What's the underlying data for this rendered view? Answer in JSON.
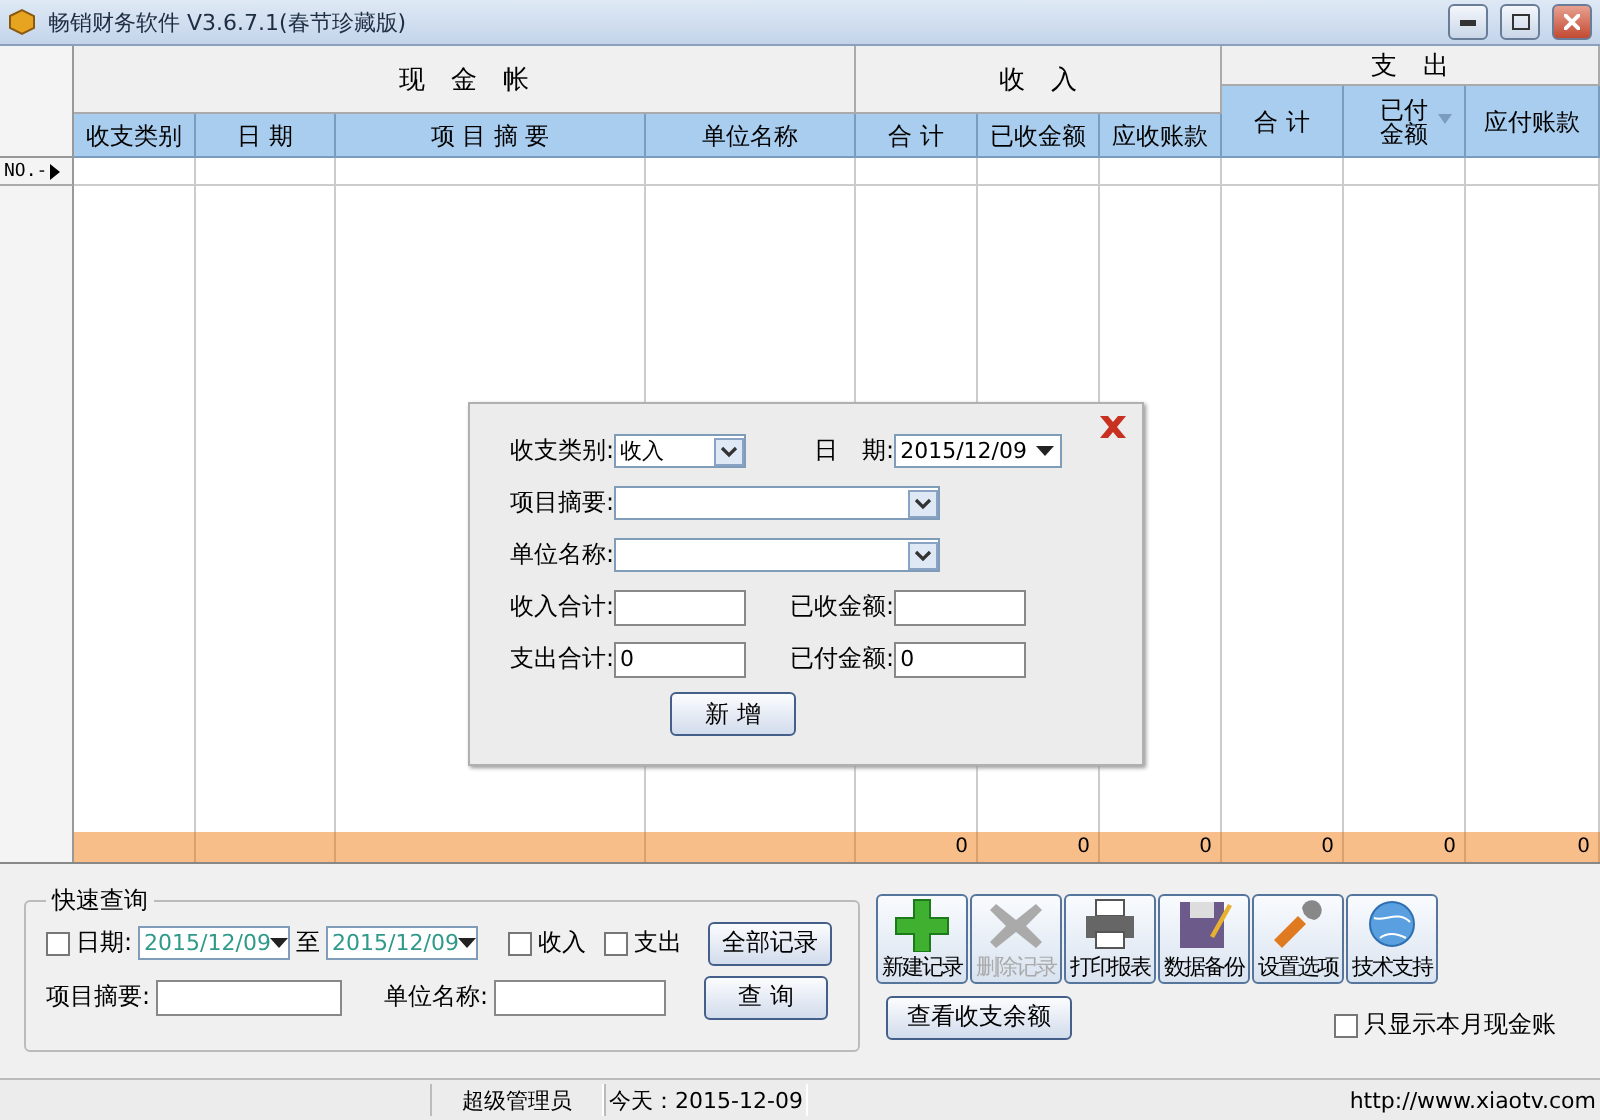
{
  "window": {
    "title": "畅销财务软件 V3.6.7.1(春节珍藏版)"
  },
  "grid": {
    "groups": [
      {
        "label": "现　金　帐"
      },
      {
        "label": "收　入"
      },
      {
        "label": "支　出"
      }
    ],
    "columns": [
      {
        "label": "收支类别",
        "filter": false
      },
      {
        "label": "日 期",
        "filter": false
      },
      {
        "label": "项 目 摘 要",
        "filter": false
      },
      {
        "label": "单位名称",
        "filter": false
      },
      {
        "label": "合 计",
        "filter": false
      },
      {
        "label": "已收金额",
        "filter": false
      },
      {
        "label": "应收账款",
        "filter": false
      },
      {
        "label": "合 计",
        "filter": false
      },
      {
        "label": "已付金额",
        "filter": true
      },
      {
        "label": "应付账款",
        "filter": false
      }
    ],
    "row_header": "NO.-",
    "totals": [
      "0",
      "0",
      "0",
      "0",
      "0",
      "0"
    ]
  },
  "dialog": {
    "type_label": "收支类别:",
    "type_value": "收入",
    "date_label": "日　期:",
    "date_value": "2015/12/09",
    "summary_label": "项目摘要:",
    "unit_label": "单位名称:",
    "income_total_label": "收入合计:",
    "received_label": "已收金额:",
    "expense_total_label": "支出合计:",
    "expense_total_value": "0",
    "paid_label": "已付金额:",
    "paid_value": "0",
    "button": "新 增"
  },
  "quick_query": {
    "title": "快速查询",
    "date_filter": {
      "label": "日期:",
      "checked": false
    },
    "from": "2015/12/09",
    "to_label": "至",
    "to": "2015/12/09",
    "income": {
      "label": "收入",
      "checked": false
    },
    "expense": {
      "label": "支出",
      "checked": false
    },
    "all_button": "全部记录",
    "summary_label": "项目摘要:",
    "unit_label": "单位名称:",
    "query_button": "查 询"
  },
  "toolbar": [
    {
      "kind": "add",
      "label": "新建记录",
      "disabled": false
    },
    {
      "kind": "delete",
      "label": "删除记录",
      "disabled": true
    },
    {
      "kind": "print",
      "label": "打印报表",
      "disabled": false
    },
    {
      "kind": "backup",
      "label": "数据备份",
      "disabled": false
    },
    {
      "kind": "settings",
      "label": "设置选项",
      "disabled": false
    },
    {
      "kind": "support",
      "label": "技术支持",
      "disabled": false
    }
  ],
  "balance_button": "查看收支余额",
  "month_only": {
    "label": "只显示本月现金账",
    "checked": false
  },
  "status_bar": {
    "user": "超级管理员",
    "today": "今天：2015-12-09",
    "url": "http://www.xiaotv.com"
  }
}
